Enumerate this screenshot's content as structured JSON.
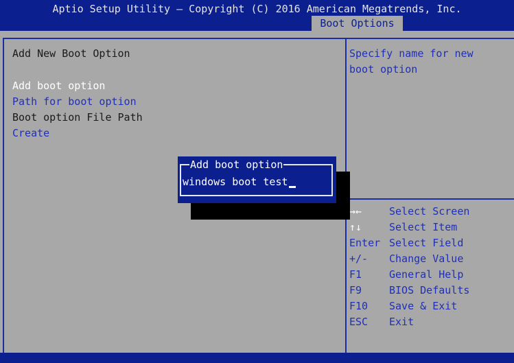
{
  "header": {
    "title": "Aptio Setup Utility – Copyright (C) 2016 American Megatrends, Inc.",
    "active_tab": "Boot Options"
  },
  "main": {
    "section_title": "Add New Boot Option",
    "items": [
      {
        "label": "Add boot option"
      },
      {
        "label": "Path for boot option"
      },
      {
        "label": "Boot option File Path"
      },
      {
        "label": "Create"
      }
    ]
  },
  "help": {
    "text": "Specify name for new\nboot option"
  },
  "keys": [
    {
      "key": "→←",
      "desc": "Select Screen"
    },
    {
      "key": "↑↓",
      "desc": "Select Item"
    },
    {
      "key": "Enter",
      "desc": "Select Field"
    },
    {
      "key": "+/-",
      "desc": "Change Value"
    },
    {
      "key": "F1",
      "desc": "General Help"
    },
    {
      "key": "F9",
      "desc": "BIOS Defaults"
    },
    {
      "key": "F10",
      "desc": "Save & Exit"
    },
    {
      "key": "ESC",
      "desc": "Exit"
    }
  ],
  "dialog": {
    "title": "Add boot option",
    "value": "windows boot test"
  },
  "colors": {
    "bar_blue": "#0c1f8e",
    "background_gray": "#a8a8a8",
    "text_blue": "#1f2fb8"
  }
}
